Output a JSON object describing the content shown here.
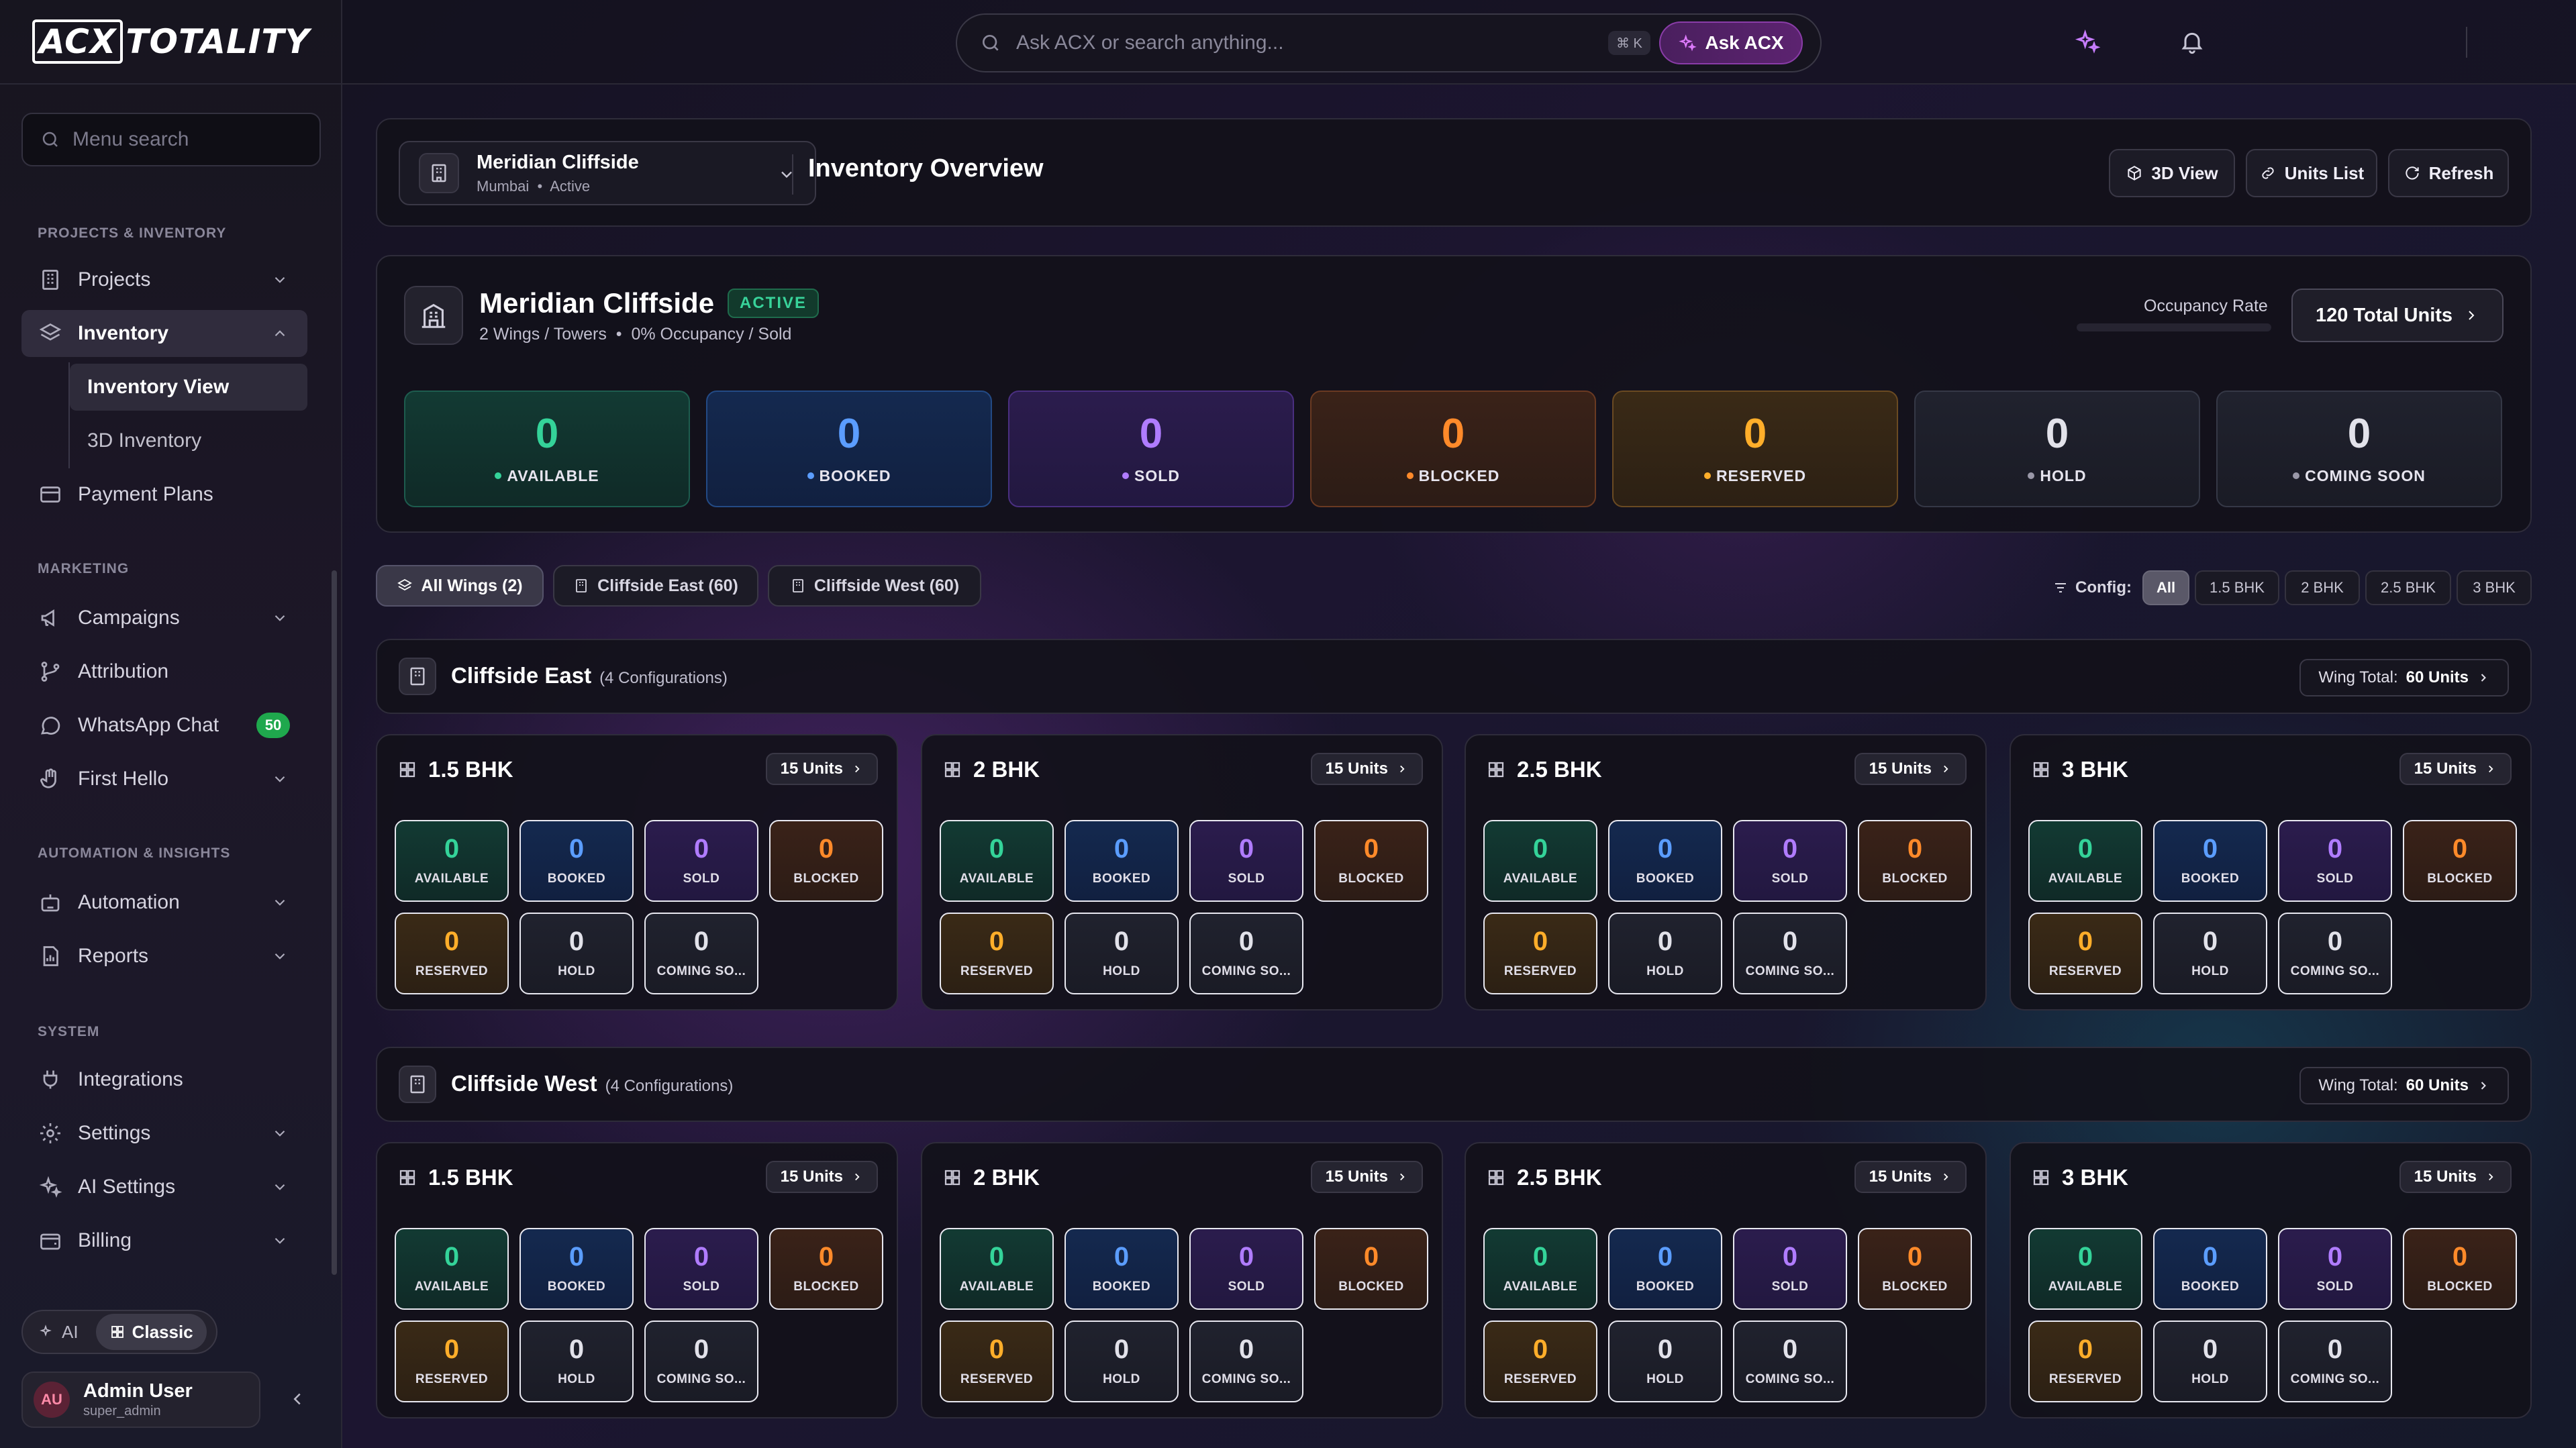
{
  "app": {
    "logo_box": "ACX",
    "logo_text": "TOTALITY"
  },
  "topbar": {
    "search_placeholder": "Ask ACX or search anything...",
    "shortcut": "⌘ K",
    "ask_label": "Ask ACX"
  },
  "sidebar": {
    "search_placeholder": "Menu search",
    "sections": {
      "projects": "PROJECTS & INVENTORY",
      "marketing": "MARKETING",
      "automation": "AUTOMATION & INSIGHTS",
      "system": "SYSTEM"
    },
    "items": {
      "projects": "Projects",
      "inventory": "Inventory",
      "inventory_view": "Inventory View",
      "inventory_3d": "3D Inventory",
      "payment_plans": "Payment Plans",
      "campaigns": "Campaigns",
      "attribution": "Attribution",
      "whatsapp": "WhatsApp Chat",
      "whatsapp_badge": "50",
      "first_hello": "First Hello",
      "automation": "Automation",
      "reports": "Reports",
      "integrations": "Integrations",
      "settings": "Settings",
      "ai_settings": "AI Settings",
      "billing": "Billing"
    },
    "mode": {
      "ai": "AI",
      "classic": "Classic"
    },
    "user": {
      "initials": "AU",
      "name": "Admin User",
      "role": "super_admin"
    }
  },
  "header": {
    "project_name": "Meridian Cliffside",
    "project_city": "Mumbai",
    "project_status": "Active",
    "title": "Inventory Overview",
    "btn_3d": "3D View",
    "btn_units": "Units List",
    "btn_refresh": "Refresh"
  },
  "summary": {
    "name": "Meridian Cliffside",
    "status": "ACTIVE",
    "wings": "2 Wings / Towers",
    "occupancy": "0% Occupancy / Sold",
    "occupancy_label": "Occupancy Rate",
    "occupancy_value": 0,
    "total_units": "120 Total Units",
    "stats": [
      {
        "value": "0",
        "label": "AVAILABLE"
      },
      {
        "value": "0",
        "label": "BOOKED"
      },
      {
        "value": "0",
        "label": "SOLD"
      },
      {
        "value": "0",
        "label": "BLOCKED"
      },
      {
        "value": "0",
        "label": "RESERVED"
      },
      {
        "value": "0",
        "label": "HOLD"
      },
      {
        "value": "0",
        "label": "COMING SOON"
      }
    ]
  },
  "filters": {
    "wings": [
      "All Wings (2)",
      "Cliffside East (60)",
      "Cliffside West (60)"
    ],
    "config_label": "Config:",
    "configs": [
      "All",
      "1.5 BHK",
      "2 BHK",
      "2.5 BHK",
      "3 BHK"
    ]
  },
  "wings": [
    {
      "name": "Cliffside East",
      "configs_note": "(4 Configurations)",
      "total_prefix": "Wing Total:",
      "total_value": "60 Units",
      "cards": [
        {
          "name": "1.5 BHK",
          "units": "15 Units",
          "stats": [
            "0",
            "0",
            "0",
            "0",
            "0",
            "0",
            "0"
          ]
        },
        {
          "name": "2 BHK",
          "units": "15 Units",
          "stats": [
            "0",
            "0",
            "0",
            "0",
            "0",
            "0",
            "0"
          ]
        },
        {
          "name": "2.5 BHK",
          "units": "15 Units",
          "stats": [
            "0",
            "0",
            "0",
            "0",
            "0",
            "0",
            "0"
          ]
        },
        {
          "name": "3 BHK",
          "units": "15 Units",
          "stats": [
            "0",
            "0",
            "0",
            "0",
            "0",
            "0",
            "0"
          ]
        }
      ]
    },
    {
      "name": "Cliffside West",
      "configs_note": "(4 Configurations)",
      "total_prefix": "Wing Total:",
      "total_value": "60 Units",
      "cards": [
        {
          "name": "1.5 BHK",
          "units": "15 Units",
          "stats": [
            "0",
            "0",
            "0",
            "0",
            "0",
            "0",
            "0"
          ]
        },
        {
          "name": "2 BHK",
          "units": "15 Units",
          "stats": [
            "0",
            "0",
            "0",
            "0",
            "0",
            "0",
            "0"
          ]
        },
        {
          "name": "2.5 BHK",
          "units": "15 Units",
          "stats": [
            "0",
            "0",
            "0",
            "0",
            "0",
            "0",
            "0"
          ]
        },
        {
          "name": "3 BHK",
          "units": "15 Units",
          "stats": [
            "0",
            "0",
            "0",
            "0",
            "0",
            "0",
            "0"
          ]
        }
      ]
    }
  ],
  "mini_labels": [
    "AVAILABLE",
    "BOOKED",
    "SOLD",
    "BLOCKED",
    "RESERVED",
    "HOLD",
    "COMING SO..."
  ],
  "colors": {
    "available": "#34d399",
    "booked": "#5b9dff",
    "sold": "#b07cff",
    "blocked": "#ff8a2a",
    "reserved": "#ffae2a",
    "accent": "#8a3ca8"
  }
}
